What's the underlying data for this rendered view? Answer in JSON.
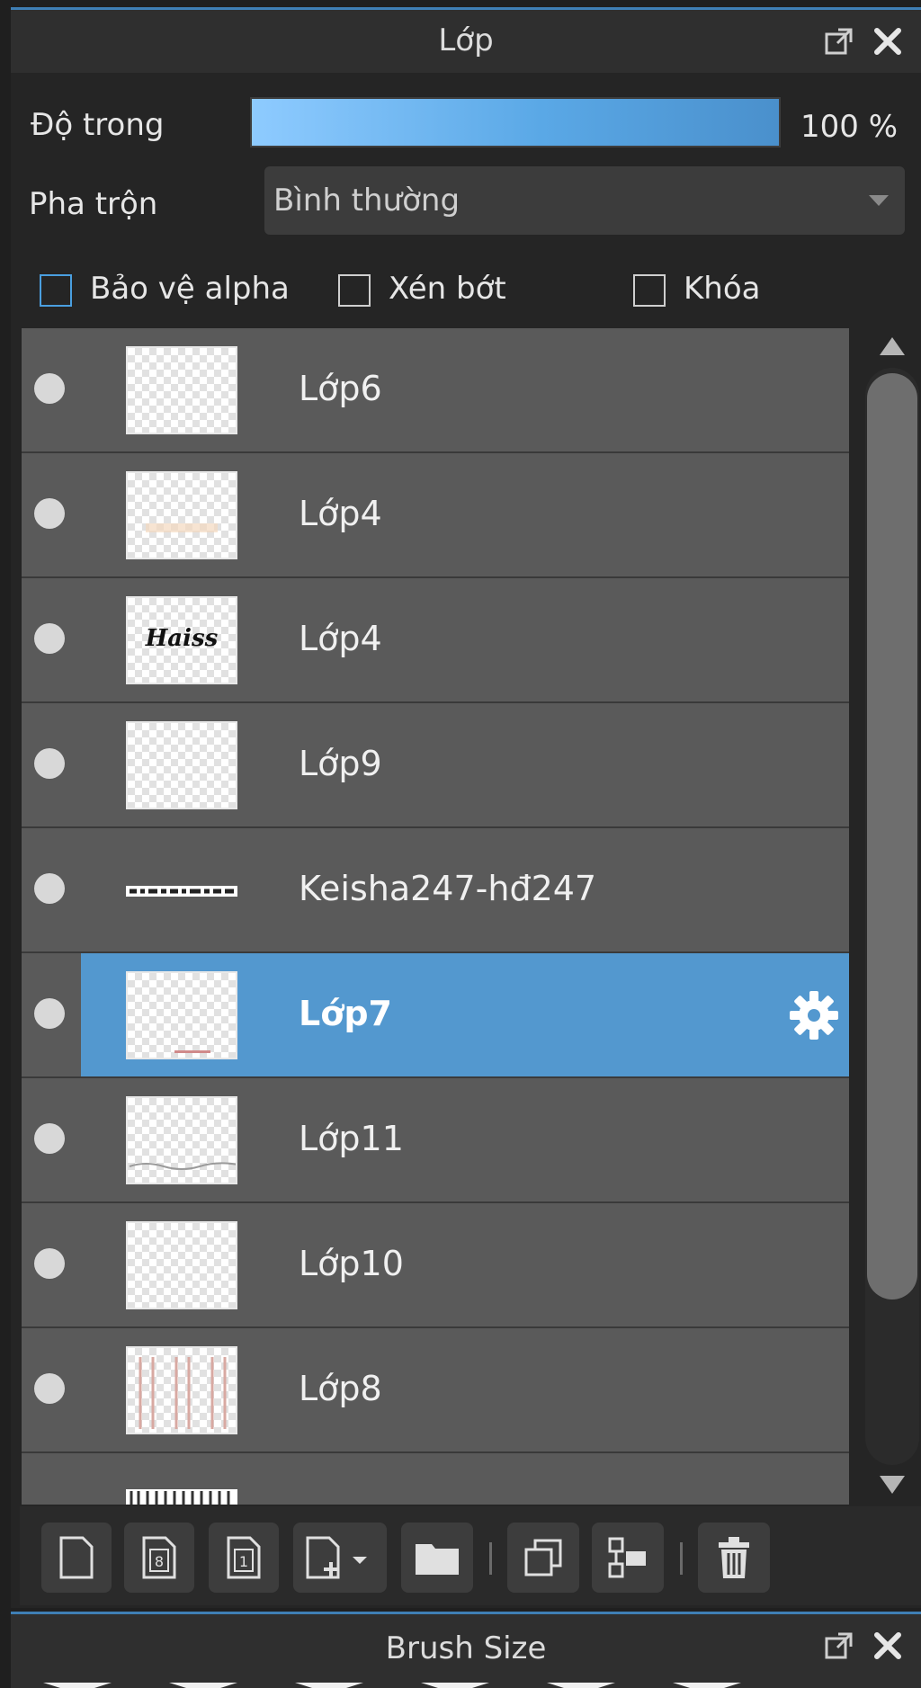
{
  "panel": {
    "title": "Lớp",
    "opacity_label": "Độ trong",
    "opacity_value": "100 %",
    "opacity_fraction": 1.0,
    "blend_label": "Pha trộn",
    "blend_value": "Bình thường",
    "checkboxes": [
      {
        "label": "Bảo vệ alpha",
        "checked": false
      },
      {
        "label": "Xén bớt",
        "checked": false
      },
      {
        "label": "Khóa",
        "checked": false
      }
    ],
    "layers": [
      {
        "name": "Lớp6",
        "selected": false
      },
      {
        "name": "Lớp4",
        "selected": false
      },
      {
        "name": "Lớp4",
        "selected": false
      },
      {
        "name": "Lớp9",
        "selected": false
      },
      {
        "name": "Keisha247-hđ247",
        "selected": false
      },
      {
        "name": "Lớp7",
        "selected": true
      },
      {
        "name": "Lớp11",
        "selected": false
      },
      {
        "name": "Lớp10",
        "selected": false
      },
      {
        "name": "Lớp8",
        "selected": false
      },
      {
        "name": "",
        "selected": false
      }
    ],
    "thumb_text": "Haiss",
    "toolbar": [
      "new-layer-icon",
      "new-8bit-layer-icon",
      "new-1bit-layer-icon",
      "add-layer-menu-icon",
      "folder-icon",
      "duplicate-icon",
      "merge-down-icon",
      "trash-icon"
    ],
    "selected_color": "#5398cf",
    "accent_color": "#3f7fb5"
  },
  "panel2": {
    "title": "Brush Size"
  }
}
